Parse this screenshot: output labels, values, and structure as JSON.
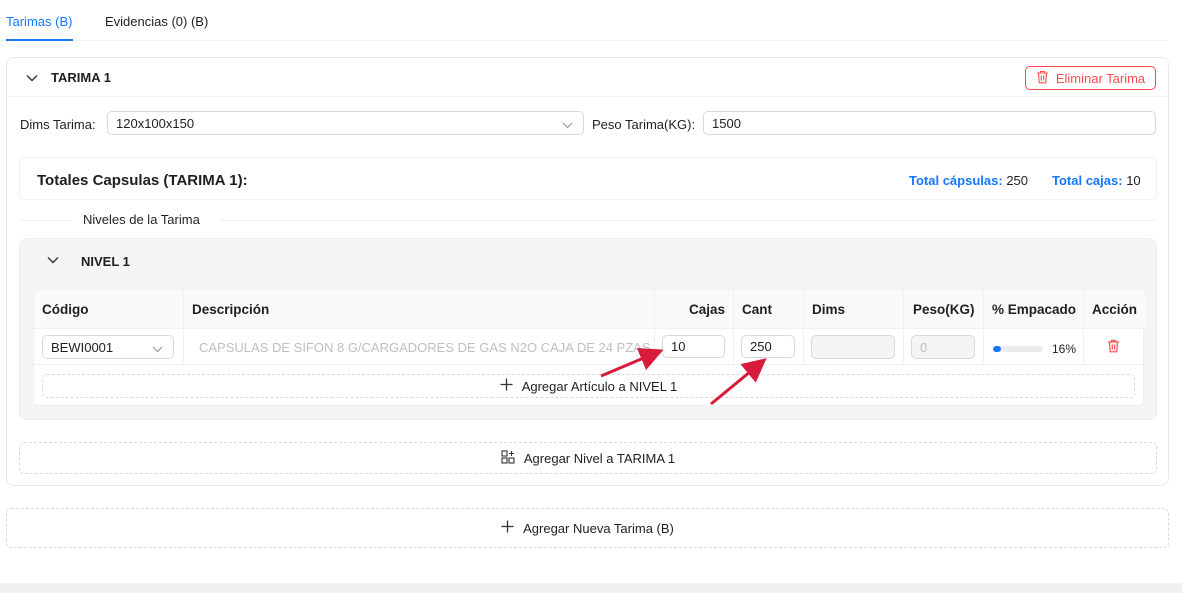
{
  "tabs": [
    {
      "label": "Tarimas (B)",
      "active": true
    },
    {
      "label": "Evidencias (0) (B)",
      "active": false
    }
  ],
  "tarima": {
    "title": "TARIMA 1",
    "delete_label": "Eliminar Tarima",
    "dims_label": "Dims Tarima",
    "dims_value": "120x100x150",
    "peso_label": "Peso Tarima(KG)",
    "peso_value": "1500",
    "totals": {
      "title": "Totales Capsulas (TARIMA 1):",
      "capsulas_label": "Total cápsulas:",
      "capsulas_value": "250",
      "cajas_label": "Total cajas:",
      "cajas_value": "10"
    },
    "niveles_label": "Niveles de la Tarima",
    "nivel": {
      "title": "NIVEL 1",
      "columns": [
        "Código",
        "Descripción",
        "Cajas",
        "Cant",
        "Dims",
        "Peso(KG)",
        "% Empacado",
        "Acción"
      ],
      "row": {
        "codigo": "BEWI0001",
        "descripcion": "CAPSULAS DE SIFON 8 G/CARGADORES DE GAS N2O CAJA DE 24 PZAS",
        "cajas": "10",
        "cant": "250",
        "dims": "",
        "peso_placeholder": "0",
        "empacado_pct": 16,
        "empacado_label": "16%"
      },
      "add_article_label": "Agregar Artículo a NIVEL 1"
    },
    "add_level_label": "Agregar Nivel a TARIMA 1"
  },
  "add_tarima_label": "Agregar Nueva Tarima (B)",
  "colors": {
    "primary": "#1677ff",
    "danger": "#ff4d4f",
    "annotation_arrow": "#d81b3a"
  },
  "icons": {
    "delete": "trash-icon",
    "collapse": "chevron-down-icon",
    "add": "plus-icon",
    "add_level": "layers-add-icon"
  }
}
